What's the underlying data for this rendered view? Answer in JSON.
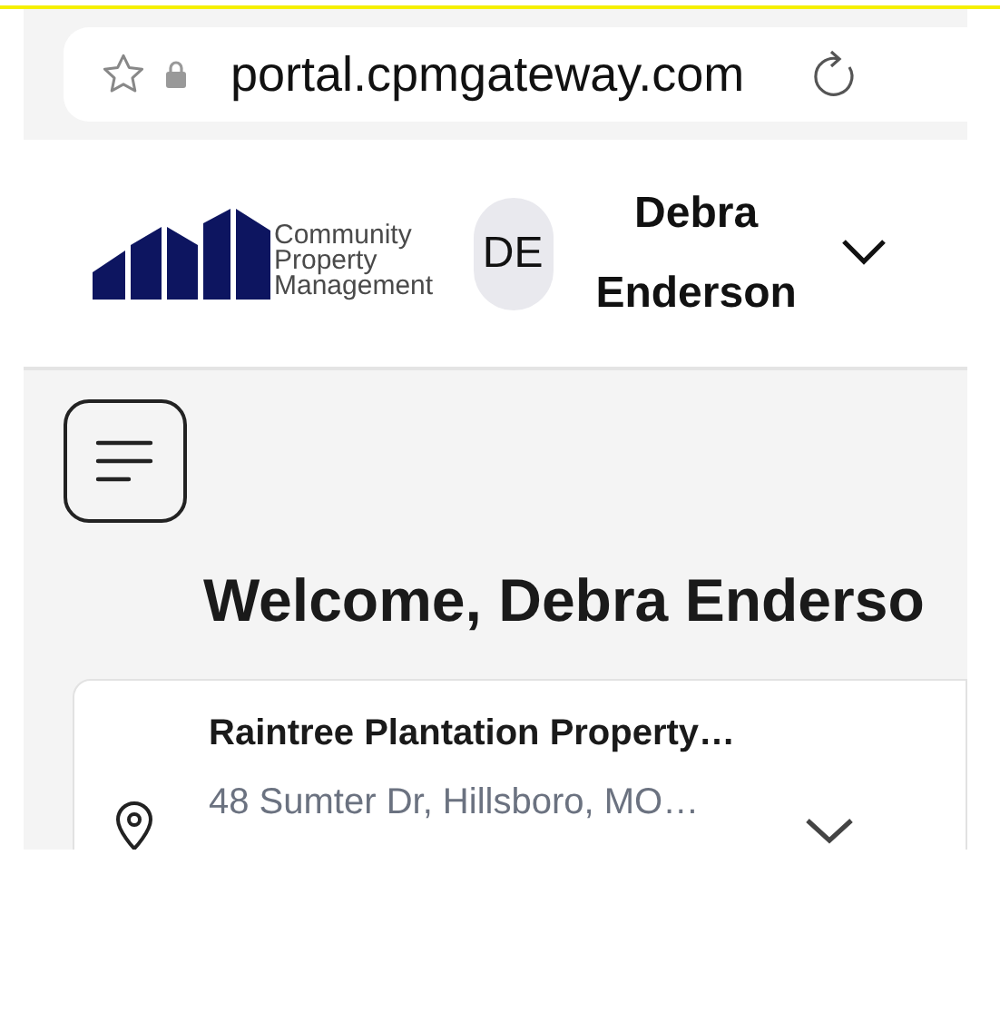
{
  "browser": {
    "url": "portal.cpmgateway.com"
  },
  "header": {
    "logo_lines": [
      "Community",
      "Property",
      "Management"
    ],
    "avatar_initials": "DE",
    "user_name": "Debra Enderson"
  },
  "page": {
    "heading": "Welcome, Debra Enderso",
    "property": {
      "name": "Raintree Plantation Property…",
      "address": "48 Sumter Dr, Hillsboro, MO…"
    }
  }
}
